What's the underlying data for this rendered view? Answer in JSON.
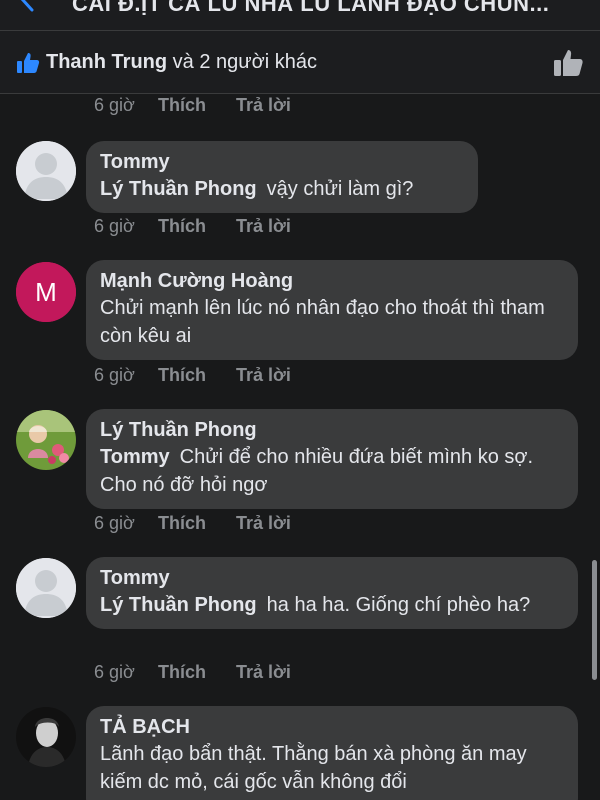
{
  "header": {
    "title": "CÁI Đ.ỊT CÁ LŨ NHÀ LŨ LÃNH ĐẠO CHÚN..."
  },
  "likes": {
    "name": "Thanh Trung",
    "rest": "và 2 người khác"
  },
  "first_actions": {
    "time": "6 giờ",
    "like": "Thích",
    "reply": "Trả lời"
  },
  "comments": [
    {
      "author": "Tommy",
      "mention": "Lý Thuần Phong",
      "text": "vậy chửi làm gì?",
      "avatar": "default-avatar",
      "time": "6 giờ",
      "like": "Thích",
      "reply": "Trả lời"
    },
    {
      "author": "Mạnh Cường Hoàng",
      "mention": "",
      "text": "Chửi mạnh lên lúc nó nhân đạo cho thoát thì tham còn kêu ai",
      "avatar": "letter-avatar",
      "avatar_letter": "M",
      "avatar_color": "#c2185b",
      "time": "6 giờ",
      "like": "Thích",
      "reply": "Trả lời"
    },
    {
      "author": "Lý Thuần Phong",
      "mention": "Tommy",
      "text": "Chửi để cho nhiều đứa biết mình ko sợ. Cho nó đỡ hỏi ngơ",
      "avatar": "photo-avatar",
      "time": "6 giờ",
      "like": "Thích",
      "reply": "Trả lời"
    },
    {
      "author": "Tommy",
      "mention": "Lý Thuần Phong",
      "text": "ha ha ha. Giống chí phèo ha?",
      "avatar": "default-avatar",
      "time": "6 giờ",
      "like": "Thích",
      "reply": "Trả lời"
    },
    {
      "author": "TẢ BẠCH",
      "mention": "",
      "text": "Lãnh đạo bẩn thật. Thằng bán xà phòng ăn may kiếm dc mỏ, cái gốc vẫn không đổi",
      "avatar": "portrait-avatar"
    }
  ],
  "colors": {
    "background": "#18191a",
    "bubble": "#3a3b3c",
    "meta": "#8a8d91",
    "like_blue": "#2d88ff"
  }
}
